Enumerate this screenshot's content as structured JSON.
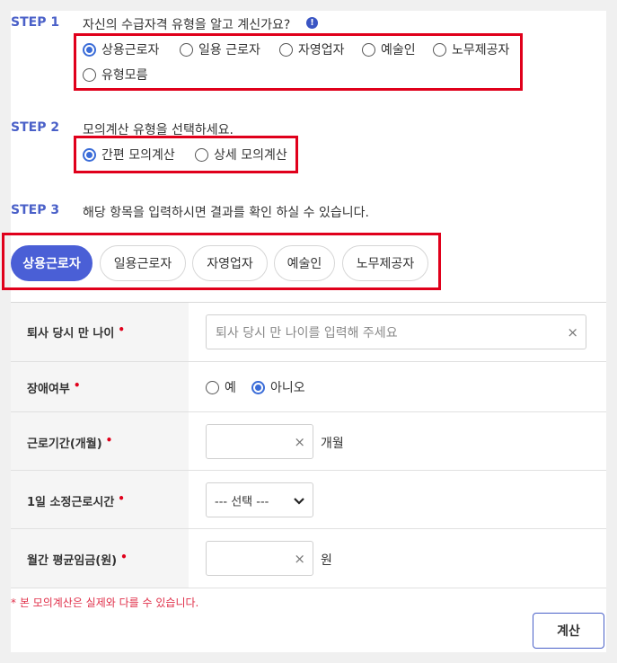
{
  "step1": {
    "label": "STEP 1",
    "text": "자신의 수급자격 유형을 알고 계신가요?",
    "info_icon": "info-icon",
    "options": [
      "상용근로자",
      "일용 근로자",
      "자영업자",
      "예술인",
      "노무제공자",
      "유형모름"
    ],
    "selected": "상용근로자"
  },
  "step2": {
    "label": "STEP 2",
    "text": "모의계산 유형을 선택하세요.",
    "options": [
      "간편 모의계산",
      "상세 모의계산"
    ],
    "selected": "간편 모의계산"
  },
  "step3": {
    "label": "STEP 3",
    "text": "해당 항목을 입력하시면 결과를 확인 하실 수 있습니다.",
    "tabs": [
      "상용근로자",
      "일용근로자",
      "자영업자",
      "예술인",
      "노무제공자"
    ],
    "active_tab": "상용근로자"
  },
  "form": {
    "age": {
      "label": "퇴사 당시 만 나이",
      "required_mark": "•",
      "placeholder": "퇴사 당시 만 나이를 입력해 주세요",
      "clear": "×"
    },
    "disability": {
      "label": "장애여부",
      "required_mark": "•",
      "options": [
        "예",
        "아니오"
      ],
      "selected": "아니오"
    },
    "tenure": {
      "label": "근로기간(개월)",
      "required_mark": "•",
      "clear": "×",
      "unit": "개월"
    },
    "hours": {
      "label": "1일 소정근로시간",
      "required_mark": "•",
      "selected_value": "--- 선택 ---"
    },
    "wage": {
      "label": "월간 평균임금(원)",
      "required_mark": "•",
      "clear": "×",
      "unit": "원"
    }
  },
  "note": "* 본 모의계산은 실제와 다를 수 있습니다.",
  "calculate_label": "계산",
  "colors": {
    "accent": "#4a5fd6",
    "highlight_box": "#e0001b",
    "required": "#e0001b"
  }
}
